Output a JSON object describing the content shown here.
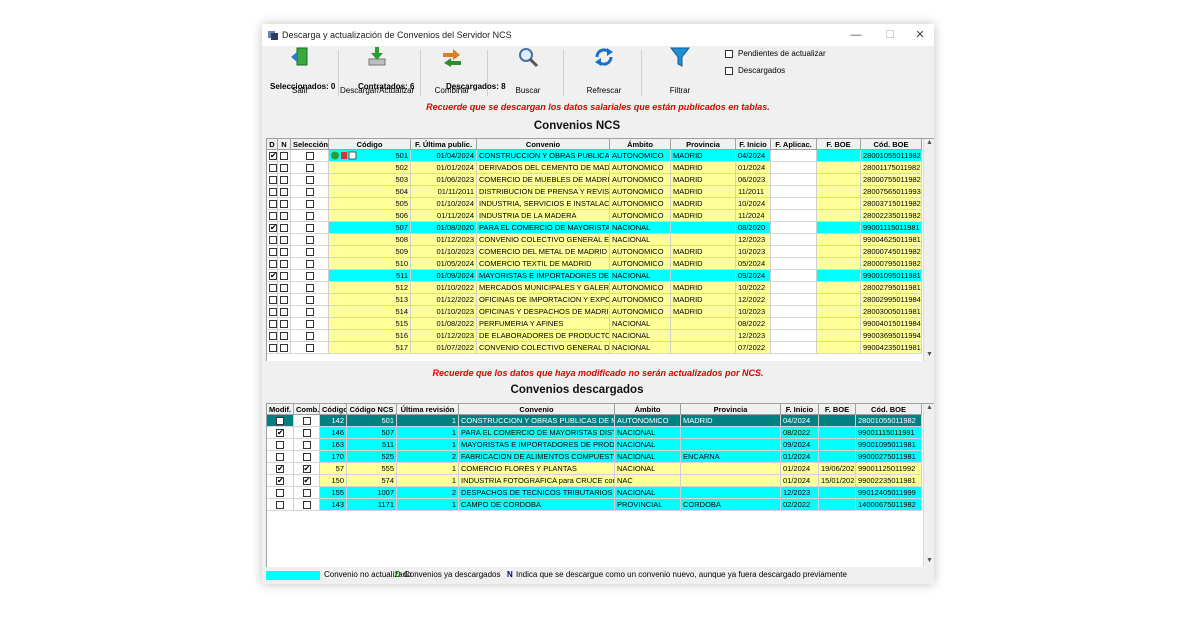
{
  "window": {
    "title": "Descarga y actualización de Convenios del Servidor NCS",
    "minimize": "—",
    "maximize": "☐",
    "close": "✕"
  },
  "toolbar": {
    "buttons": [
      {
        "label": "Salir",
        "icon": "exit-door-icon"
      },
      {
        "label": "Descargar/Actualizar",
        "icon": "download-icon"
      },
      {
        "label": "Combinar",
        "icon": "combine-arrows-icon"
      },
      {
        "label": "Buscar",
        "icon": "magnifier-icon"
      },
      {
        "label": "Refrescar",
        "icon": "refresh-icon"
      },
      {
        "label": "Filtrar",
        "icon": "funnel-icon"
      }
    ],
    "options": [
      {
        "label": "Pendientes de actualizar",
        "checked": false
      },
      {
        "label": "Descargados",
        "checked": false
      }
    ]
  },
  "counts": {
    "selected": "Seleccionados: 0",
    "contracted": "Contratados: 6",
    "downloaded": "Descargados: 8"
  },
  "notice_top": "Recuerde que se descargan los datos salariales que están publicados en tablas.",
  "ncs": {
    "heading": "Convenios NCS",
    "headers": [
      "D",
      "N",
      "Selección",
      "Código",
      "F. Última public.",
      "Convenio",
      "Ámbito",
      "Provincia",
      "F. Inicio",
      "F. Aplicac.",
      "F. BOE",
      "Cód. BOE"
    ],
    "rows": [
      {
        "d": true,
        "n": false,
        "sel": false,
        "codigo": "501",
        "fecha": "01/04/2024",
        "convenio": "CONSTRUCCION Y OBRAS PUBLICAS (",
        "ambito": "AUTONOMICO",
        "provincia": "MADRID",
        "inicio": "04/2024",
        "aplic": "",
        "boe": "",
        "cod_boe": "28001055011982",
        "hl": "cy",
        "icons": true
      },
      {
        "d": false,
        "n": false,
        "sel": false,
        "codigo": "502",
        "fecha": "01/01/2024",
        "convenio": "DERIVADOS DEL CEMENTO DE MADR",
        "ambito": "AUTONOMICO",
        "provincia": "MADRID",
        "inicio": "01/2024",
        "aplic": "",
        "boe": "",
        "cod_boe": "28001175011982",
        "hl": "ye"
      },
      {
        "d": false,
        "n": false,
        "sel": false,
        "codigo": "503",
        "fecha": "01/06/2023",
        "convenio": "COMERCIO DE MUEBLES DE MADRID",
        "ambito": "AUTONOMICO",
        "provincia": "MADRID",
        "inicio": "06/2023",
        "aplic": "",
        "boe": "",
        "cod_boe": "28000755011982",
        "hl": "ye"
      },
      {
        "d": false,
        "n": false,
        "sel": false,
        "codigo": "504",
        "fecha": "01/11/2011",
        "convenio": "DISTRIBUCION DE PRENSA Y REVIST",
        "ambito": "AUTONOMICO",
        "provincia": "MADRID",
        "inicio": "11/2011",
        "aplic": "",
        "boe": "",
        "cod_boe": "28007565011993",
        "hl": "ye"
      },
      {
        "d": false,
        "n": false,
        "sel": false,
        "codigo": "505",
        "fecha": "01/10/2024",
        "convenio": "INDUSTRIA, SERVICIOS E INSTALACIO",
        "ambito": "AUTONOMICO",
        "provincia": "MADRID",
        "inicio": "10/2024",
        "aplic": "",
        "boe": "",
        "cod_boe": "28003715011982",
        "hl": "ye"
      },
      {
        "d": false,
        "n": false,
        "sel": false,
        "codigo": "506",
        "fecha": "01/11/2024",
        "convenio": "INDUSTRIA DE LA MADERA",
        "ambito": "AUTONOMICO",
        "provincia": "MADRID",
        "inicio": "11/2024",
        "aplic": "",
        "boe": "",
        "cod_boe": "28002235011982",
        "hl": "ye"
      },
      {
        "d": true,
        "n": false,
        "sel": false,
        "codigo": "507",
        "fecha": "01/08/2020",
        "convenio": "PARA EL COMERCIO DE MAYORISTAS",
        "ambito": "NACIONAL",
        "provincia": "",
        "inicio": "08/2020",
        "aplic": "",
        "boe": "",
        "cod_boe": "99001115011981",
        "hl": "cy"
      },
      {
        "d": false,
        "n": false,
        "sel": false,
        "codigo": "508",
        "fecha": "01/12/2023",
        "convenio": "CONVENIO COLECTIVO GENERAL EST",
        "ambito": "NACIONAL",
        "provincia": "",
        "inicio": "12/2023",
        "aplic": "",
        "boe": "",
        "cod_boe": "99004625011981",
        "hl": "ye"
      },
      {
        "d": false,
        "n": false,
        "sel": false,
        "codigo": "509",
        "fecha": "01/10/2023",
        "convenio": "COMERCIO DEL METAL DE MADRID",
        "ambito": "AUTONOMICO",
        "provincia": "MADRID",
        "inicio": "10/2023",
        "aplic": "",
        "boe": "",
        "cod_boe": "28000745011982",
        "hl": "ye"
      },
      {
        "d": false,
        "n": false,
        "sel": false,
        "codigo": "510",
        "fecha": "01/05/2024",
        "convenio": "COMERCIO TEXTIL DE MADRID",
        "ambito": "AUTONOMICO",
        "provincia": "MADRID",
        "inicio": "05/2024",
        "aplic": "",
        "boe": "",
        "cod_boe": "28000795011982",
        "hl": "ye"
      },
      {
        "d": true,
        "n": false,
        "sel": false,
        "codigo": "511",
        "fecha": "01/09/2024",
        "convenio": "MAYORISTAS E IMPORTADORES DE F",
        "ambito": "NACIONAL",
        "provincia": "",
        "inicio": "09/2024",
        "aplic": "",
        "boe": "",
        "cod_boe": "99001095011981",
        "hl": "cy"
      },
      {
        "d": false,
        "n": false,
        "sel": false,
        "codigo": "512",
        "fecha": "01/10/2022",
        "convenio": "MERCADOS MUNICIPALES Y GALERIA",
        "ambito": "AUTONOMICO",
        "provincia": "MADRID",
        "inicio": "10/2022",
        "aplic": "",
        "boe": "",
        "cod_boe": "28002795011981",
        "hl": "ye"
      },
      {
        "d": false,
        "n": false,
        "sel": false,
        "codigo": "513",
        "fecha": "01/12/2022",
        "convenio": "OFICINAS DE IMPORTACION Y EXPOR",
        "ambito": "AUTONOMICO",
        "provincia": "MADRID",
        "inicio": "12/2022",
        "aplic": "",
        "boe": "",
        "cod_boe": "28002995011984",
        "hl": "ye"
      },
      {
        "d": false,
        "n": false,
        "sel": false,
        "codigo": "514",
        "fecha": "01/10/2023",
        "convenio": "OFICINAS Y DESPACHOS DE MADRID",
        "ambito": "AUTONOMICO",
        "provincia": "MADRID",
        "inicio": "10/2023",
        "aplic": "",
        "boe": "",
        "cod_boe": "28003005011981",
        "hl": "ye"
      },
      {
        "d": false,
        "n": false,
        "sel": false,
        "codigo": "515",
        "fecha": "01/08/2022",
        "convenio": "PERFUMERIA Y AFINES",
        "ambito": "NACIONAL",
        "provincia": "",
        "inicio": "08/2022",
        "aplic": "",
        "boe": "",
        "cod_boe": "99004015011984",
        "hl": "ye"
      },
      {
        "d": false,
        "n": false,
        "sel": false,
        "codigo": "516",
        "fecha": "01/12/2023",
        "convenio": "DE ELABORADORES DE PRODUCTOS",
        "ambito": "NACIONAL",
        "provincia": "",
        "inicio": "12/2023",
        "aplic": "",
        "boe": "",
        "cod_boe": "99003695011994",
        "hl": "ye"
      },
      {
        "d": false,
        "n": false,
        "sel": false,
        "codigo": "517",
        "fecha": "01/07/2022",
        "convenio": "CONVENIO COLECTIVO GENERAL DE L",
        "ambito": "NACIONAL",
        "provincia": "",
        "inicio": "07/2022",
        "aplic": "",
        "boe": "",
        "cod_boe": "99004235011981",
        "hl": "ye"
      }
    ]
  },
  "notice_mid": "Recuerde que los datos que haya modificado no serán actualizados por NCS.",
  "down": {
    "heading": "Convenios descargados",
    "headers": [
      "Modif.",
      "Comb.",
      "Código",
      "Código NCS",
      "Última revisión",
      "Convenio",
      "Ámbito",
      "Provincia",
      "F. Inicio",
      "F. BOE",
      "Cód. BOE"
    ],
    "rows": [
      {
        "modif": false,
        "comb": false,
        "codigo": "142",
        "ncs": "501",
        "rev": "1",
        "convenio": "CONSTRUCCION Y OBRAS PUBLICAS DE MADRI",
        "ambito": "AUTONOMICO",
        "provincia": "MADRID",
        "inicio": "04/2024",
        "boe": "",
        "cod_boe": "28001055011982",
        "hl": "sel"
      },
      {
        "modif": true,
        "comb": false,
        "codigo": "146",
        "ncs": "507",
        "rev": "1",
        "convenio": "PARA EL COMERCIO DE MAYORISTAS DISTRI",
        "ambito": "NACIONAL",
        "provincia": "",
        "inicio": "08/2022",
        "boe": "",
        "cod_boe": "99001115011981",
        "hl": "cy"
      },
      {
        "modif": false,
        "comb": false,
        "codigo": "163",
        "ncs": "511",
        "rev": "1",
        "convenio": "MAYORISTAS E IMPORTADORES DE PRODUC",
        "ambito": "NACIONAL",
        "provincia": "",
        "inicio": "09/2024",
        "boe": "",
        "cod_boe": "99001095011981",
        "hl": "cy"
      },
      {
        "modif": false,
        "comb": false,
        "codigo": "170",
        "ncs": "525",
        "rev": "2",
        "convenio": "FABRICACION DE ALIMENTOS COMPUESTOS",
        "ambito": "NACIONAL",
        "provincia": "ENCARNA",
        "inicio": "01/2024",
        "boe": "",
        "cod_boe": "99000275011981",
        "hl": "cy"
      },
      {
        "modif": true,
        "comb": true,
        "codigo": "57",
        "ncs": "555",
        "rev": "1",
        "convenio": "COMERCIO FLORES Y PLANTAS",
        "ambito": "NACIONAL",
        "provincia": "",
        "inicio": "01/2024",
        "boe": "19/06/202",
        "cod_boe": "99001125011992",
        "hl": "ye"
      },
      {
        "modif": true,
        "comb": true,
        "codigo": "150",
        "ncs": "574",
        "rev": "1",
        "convenio": "INDUSTRIA FOTOGRAFICA para CRUCE con C",
        "ambito": "NAC",
        "provincia": "",
        "inicio": "01/2024",
        "boe": "15/01/202",
        "cod_boe": "99002235011981",
        "hl": "ye"
      },
      {
        "modif": false,
        "comb": false,
        "codigo": "155",
        "ncs": "1007",
        "rev": "2",
        "convenio": "DESPACHOS DE TECNICOS TRIBUTARIOS Y A",
        "ambito": "NACIONAL",
        "provincia": "",
        "inicio": "12/2023",
        "boe": "",
        "cod_boe": "99012405011999",
        "hl": "cy"
      },
      {
        "modif": false,
        "comb": false,
        "codigo": "143",
        "ncs": "1171",
        "rev": "1",
        "convenio": "CAMPO DE CORDOBA",
        "ambito": "PROVINCIAL",
        "provincia": "CORDOBA",
        "inicio": "02/2022",
        "boe": "",
        "cod_boe": "14000675011982",
        "hl": "cy"
      }
    ]
  },
  "legend": {
    "not_updated": "Convenio no actualizado",
    "d_letter": "D",
    "d_text": "Convenios ya descargados",
    "n_letter": "N",
    "n_text": "Indica que se descargue como un convenio nuevo, aunque ya fuera descargado previamente"
  },
  "colors": {
    "cyan": "#00ffff",
    "yellow": "#ffff99",
    "selected": "#008080",
    "notice": "#e00000",
    "legend_d": "#008000",
    "legend_n": "#000080"
  }
}
